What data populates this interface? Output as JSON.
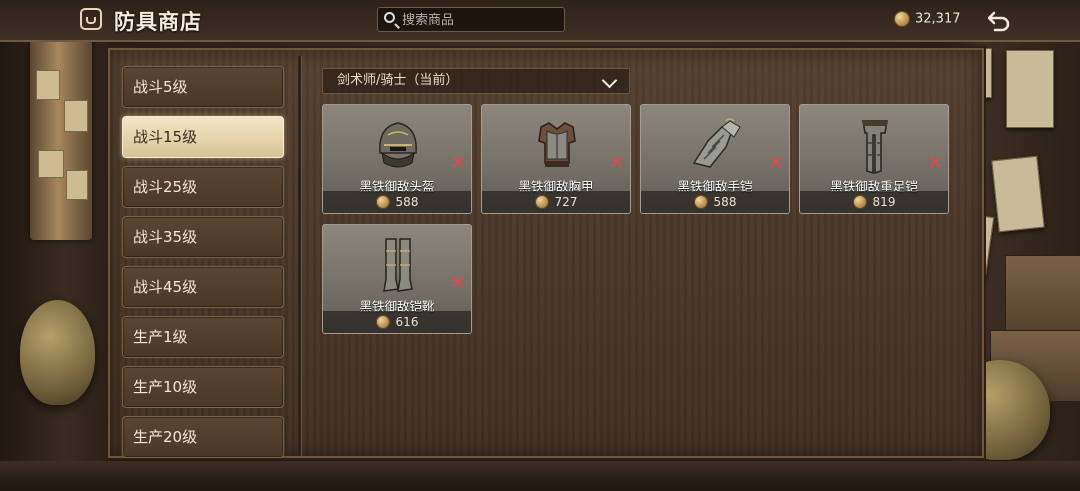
{
  "header": {
    "title": "防具商店",
    "search_placeholder": "搜索商品",
    "currency_amount": "32,317"
  },
  "sidebar": {
    "items": [
      {
        "label": "战斗5级",
        "active": false
      },
      {
        "label": "战斗15级",
        "active": true
      },
      {
        "label": "战斗25级",
        "active": false
      },
      {
        "label": "战斗35级",
        "active": false
      },
      {
        "label": "战斗45级",
        "active": false
      },
      {
        "label": "生产1级",
        "active": false
      },
      {
        "label": "生产10级",
        "active": false
      },
      {
        "label": "生产20级",
        "active": false
      }
    ]
  },
  "filter": {
    "class_selected": "剑术师/骑士（当前）"
  },
  "items": [
    {
      "name": "黑铁御敌头盔",
      "price": "588",
      "icon": "helmet-icon"
    },
    {
      "name": "黑铁御敌胸甲",
      "price": "727",
      "icon": "chest-armor-icon"
    },
    {
      "name": "黑铁御敌手铠",
      "price": "588",
      "icon": "gauntlet-icon"
    },
    {
      "name": "黑铁御敌重足铠",
      "price": "819",
      "icon": "leg-armor-icon"
    },
    {
      "name": "黑铁御敌铠靴",
      "price": "616",
      "icon": "boots-icon"
    }
  ],
  "colors": {
    "accent_active": "#f3e6c6",
    "unusable_mark": "#e04a4a",
    "coin": "#b5884a"
  }
}
